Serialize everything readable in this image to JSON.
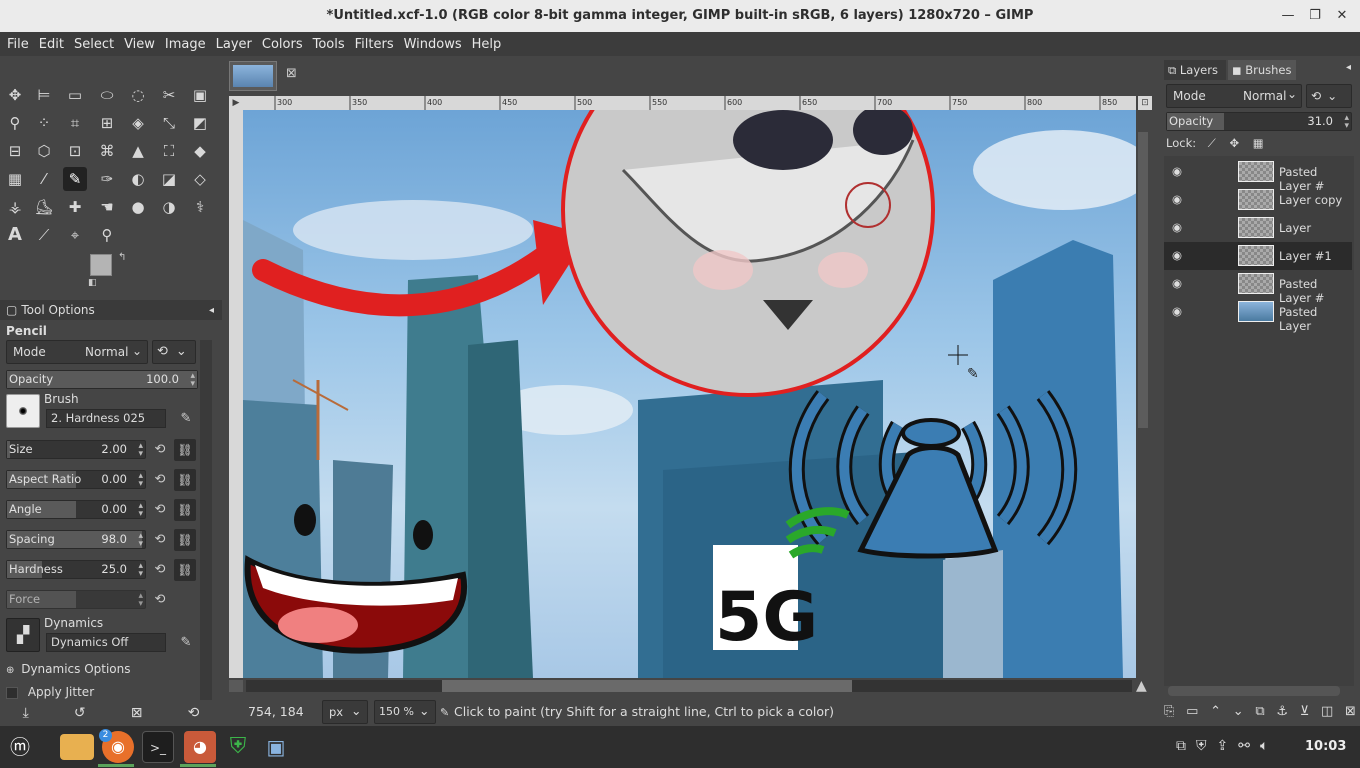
{
  "window": {
    "title": "*Untitled.xcf-1.0 (RGB color 8-bit gamma integer, GIMP built-in sRGB, 6 layers) 1280x720 – GIMP",
    "controls": [
      "minimize-icon",
      "maximize-icon",
      "close-icon"
    ]
  },
  "menu": [
    "File",
    "Edit",
    "Select",
    "View",
    "Image",
    "Layer",
    "Colors",
    "Tools",
    "Filters",
    "Windows",
    "Help"
  ],
  "toolbox": {
    "icons": [
      "move-icon",
      "align-icon",
      "rect-select-icon",
      "ellipse-select-icon",
      "free-select-icon",
      "scissors-icon",
      "foreground-select-icon",
      "fuzzy-select-icon",
      "select-by-color-icon",
      "crop-icon",
      "unified-transform-icon",
      "warp-icon",
      "cage-icon",
      "flip-icon",
      "handle-transform-icon",
      "perspective-icon",
      "3d-transform-icon",
      "seamless-clone-icon",
      "paths-icon",
      "perspective-clone-icon",
      "bucket-fill-icon",
      "gradient-icon",
      "paintbrush-icon",
      "pencil-icon",
      "airbrush-icon",
      "ink-icon",
      "mypaint-brush-icon",
      "eraser-icon",
      "clone-icon",
      "heal-icon",
      "blur-icon",
      "smudge-icon",
      "dodge-burn-icon",
      "text-tool-icon",
      "color-picker-icon",
      "text-icon",
      "eyedropper-icon",
      "measure-icon",
      "zoom-icon"
    ],
    "active": "pencil-icon",
    "fg_color": "#b4b4b4",
    "bg_color": "#000000"
  },
  "tool_options": {
    "tab": "Tool Options",
    "tool_name": "Pencil",
    "mode_label": "Mode",
    "mode_value": "Normal",
    "opacity": {
      "label": "Opacity",
      "value": "100.0",
      "fraction": 1.0
    },
    "brush_label": "Brush",
    "brush_value": "2. Hardness 025",
    "size": {
      "label": "Size",
      "value": "2.00",
      "fraction": 0.02
    },
    "aspect": {
      "label": "Aspect Ratio",
      "value": "0.00",
      "fraction": 0.5
    },
    "angle": {
      "label": "Angle",
      "value": "0.00",
      "fraction": 0.5
    },
    "spacing": {
      "label": "Spacing",
      "value": "98.0",
      "fraction": 0.98
    },
    "hardness": {
      "label": "Hardness",
      "value": "25.0",
      "fraction": 0.25
    },
    "force": {
      "label": "Force",
      "value": "",
      "fraction": 0.5
    },
    "dynamics_label": "Dynamics",
    "dynamics_value": "Dynamics Off",
    "dynamics_options": "Dynamics Options",
    "apply_jitter": "Apply Jitter"
  },
  "canvas": {
    "ruler_ticks": [
      "300",
      "350",
      "400",
      "450",
      "500",
      "550",
      "600",
      "650",
      "700",
      "750",
      "800",
      "850"
    ],
    "coords": "754, 184",
    "unit": "px",
    "zoom": "150 %",
    "status": "Click to paint (try Shift for a straight line, Ctrl to pick a color)",
    "label_5g": "5G"
  },
  "layers": {
    "tab_layers": "Layers",
    "tab_brushes": "Brushes",
    "mode_label": "Mode",
    "mode_value": "Normal",
    "opacity_label": "Opacity",
    "opacity_value": "31.0",
    "opacity_fraction": 0.31,
    "lock_label": "Lock:",
    "items": [
      {
        "name": "Pasted Layer #",
        "selected": false
      },
      {
        "name": "Layer copy",
        "selected": false
      },
      {
        "name": "Layer",
        "selected": false
      },
      {
        "name": "Layer #1",
        "selected": true
      },
      {
        "name": "Pasted Layer #",
        "selected": false
      },
      {
        "name": "Pasted Layer",
        "selected": false
      }
    ]
  },
  "taskbar": {
    "apps": [
      "mint-menu-icon",
      "files-icon",
      "firefox-icon",
      "terminal-icon",
      "gimp-icon",
      "shield-icon",
      "screenshot-icon"
    ],
    "firefox_badge": "2",
    "clock": "10:03"
  }
}
